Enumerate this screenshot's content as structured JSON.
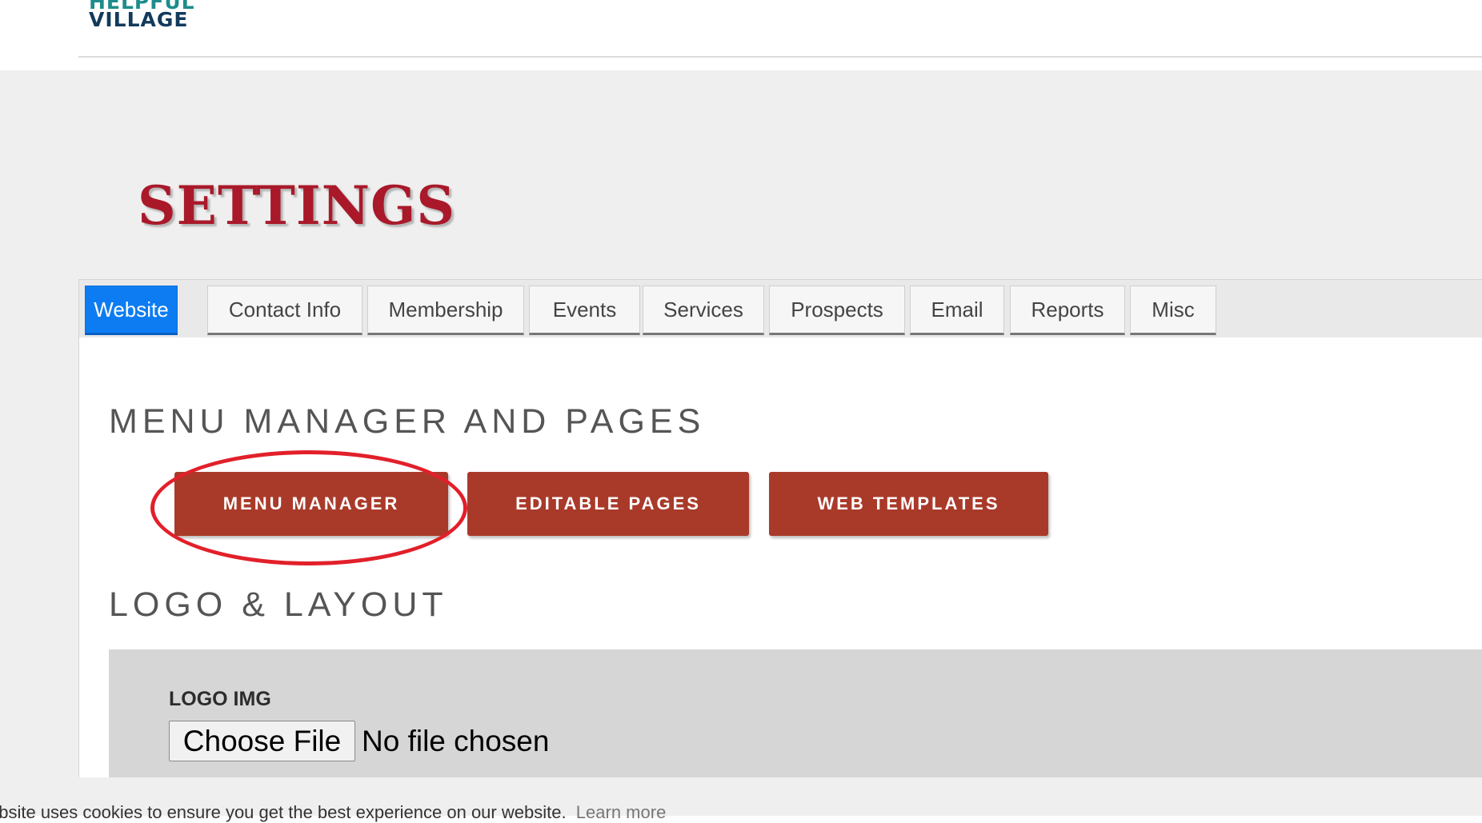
{
  "brand": {
    "line1": "HELPFUL",
    "line2": "VILLAGE"
  },
  "page": {
    "title": "SETTINGS"
  },
  "tabs": [
    {
      "label": "Website",
      "active": true
    },
    {
      "label": "Contact Info",
      "active": false
    },
    {
      "label": "Membership",
      "active": false
    },
    {
      "label": "Events",
      "active": false
    },
    {
      "label": "Services",
      "active": false
    },
    {
      "label": "Prospects",
      "active": false
    },
    {
      "label": "Email",
      "active": false
    },
    {
      "label": "Reports",
      "active": false
    },
    {
      "label": "Misc",
      "active": false
    }
  ],
  "menu_section": {
    "heading": "MENU MANAGER AND PAGES",
    "buttons": {
      "menu_manager": "MENU MANAGER",
      "editable_pages": "EDITABLE PAGES",
      "web_templates": "WEB TEMPLATES"
    }
  },
  "layout_section": {
    "heading": "LOGO & LAYOUT",
    "logo_label": "LOGO IMG",
    "file_button": "Choose File",
    "file_status": "No file chosen"
  },
  "cookie_bar": {
    "text": "ebsite uses cookies to ensure you get the best experience on our website.",
    "link": "Learn more"
  },
  "colors": {
    "title_red": "#a9192a",
    "button_red": "#a93a2a",
    "tab_active_blue": "#0d7cf2",
    "highlight_ring": "#e2202a"
  }
}
